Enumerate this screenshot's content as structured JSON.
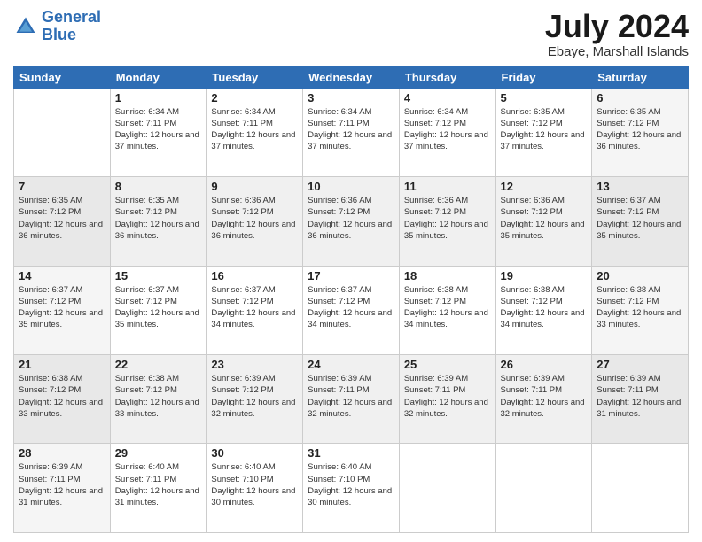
{
  "header": {
    "logo_line1": "General",
    "logo_line2": "Blue",
    "month_year": "July 2024",
    "location": "Ebaye, Marshall Islands"
  },
  "weekdays": [
    "Sunday",
    "Monday",
    "Tuesday",
    "Wednesday",
    "Thursday",
    "Friday",
    "Saturday"
  ],
  "weeks": [
    [
      {
        "day": "",
        "sunrise": "",
        "sunset": "",
        "daylight": ""
      },
      {
        "day": "1",
        "sunrise": "6:34 AM",
        "sunset": "7:11 PM",
        "daylight": "12 hours and 37 minutes."
      },
      {
        "day": "2",
        "sunrise": "6:34 AM",
        "sunset": "7:11 PM",
        "daylight": "12 hours and 37 minutes."
      },
      {
        "day": "3",
        "sunrise": "6:34 AM",
        "sunset": "7:11 PM",
        "daylight": "12 hours and 37 minutes."
      },
      {
        "day": "4",
        "sunrise": "6:34 AM",
        "sunset": "7:12 PM",
        "daylight": "12 hours and 37 minutes."
      },
      {
        "day": "5",
        "sunrise": "6:35 AM",
        "sunset": "7:12 PM",
        "daylight": "12 hours and 37 minutes."
      },
      {
        "day": "6",
        "sunrise": "6:35 AM",
        "sunset": "7:12 PM",
        "daylight": "12 hours and 36 minutes."
      }
    ],
    [
      {
        "day": "7",
        "sunrise": "6:35 AM",
        "sunset": "7:12 PM",
        "daylight": "12 hours and 36 minutes."
      },
      {
        "day": "8",
        "sunrise": "6:35 AM",
        "sunset": "7:12 PM",
        "daylight": "12 hours and 36 minutes."
      },
      {
        "day": "9",
        "sunrise": "6:36 AM",
        "sunset": "7:12 PM",
        "daylight": "12 hours and 36 minutes."
      },
      {
        "day": "10",
        "sunrise": "6:36 AM",
        "sunset": "7:12 PM",
        "daylight": "12 hours and 36 minutes."
      },
      {
        "day": "11",
        "sunrise": "6:36 AM",
        "sunset": "7:12 PM",
        "daylight": "12 hours and 35 minutes."
      },
      {
        "day": "12",
        "sunrise": "6:36 AM",
        "sunset": "7:12 PM",
        "daylight": "12 hours and 35 minutes."
      },
      {
        "day": "13",
        "sunrise": "6:37 AM",
        "sunset": "7:12 PM",
        "daylight": "12 hours and 35 minutes."
      }
    ],
    [
      {
        "day": "14",
        "sunrise": "6:37 AM",
        "sunset": "7:12 PM",
        "daylight": "12 hours and 35 minutes."
      },
      {
        "day": "15",
        "sunrise": "6:37 AM",
        "sunset": "7:12 PM",
        "daylight": "12 hours and 35 minutes."
      },
      {
        "day": "16",
        "sunrise": "6:37 AM",
        "sunset": "7:12 PM",
        "daylight": "12 hours and 34 minutes."
      },
      {
        "day": "17",
        "sunrise": "6:37 AM",
        "sunset": "7:12 PM",
        "daylight": "12 hours and 34 minutes."
      },
      {
        "day": "18",
        "sunrise": "6:38 AM",
        "sunset": "7:12 PM",
        "daylight": "12 hours and 34 minutes."
      },
      {
        "day": "19",
        "sunrise": "6:38 AM",
        "sunset": "7:12 PM",
        "daylight": "12 hours and 34 minutes."
      },
      {
        "day": "20",
        "sunrise": "6:38 AM",
        "sunset": "7:12 PM",
        "daylight": "12 hours and 33 minutes."
      }
    ],
    [
      {
        "day": "21",
        "sunrise": "6:38 AM",
        "sunset": "7:12 PM",
        "daylight": "12 hours and 33 minutes."
      },
      {
        "day": "22",
        "sunrise": "6:38 AM",
        "sunset": "7:12 PM",
        "daylight": "12 hours and 33 minutes."
      },
      {
        "day": "23",
        "sunrise": "6:39 AM",
        "sunset": "7:12 PM",
        "daylight": "12 hours and 32 minutes."
      },
      {
        "day": "24",
        "sunrise": "6:39 AM",
        "sunset": "7:11 PM",
        "daylight": "12 hours and 32 minutes."
      },
      {
        "day": "25",
        "sunrise": "6:39 AM",
        "sunset": "7:11 PM",
        "daylight": "12 hours and 32 minutes."
      },
      {
        "day": "26",
        "sunrise": "6:39 AM",
        "sunset": "7:11 PM",
        "daylight": "12 hours and 32 minutes."
      },
      {
        "day": "27",
        "sunrise": "6:39 AM",
        "sunset": "7:11 PM",
        "daylight": "12 hours and 31 minutes."
      }
    ],
    [
      {
        "day": "28",
        "sunrise": "6:39 AM",
        "sunset": "7:11 PM",
        "daylight": "12 hours and 31 minutes."
      },
      {
        "day": "29",
        "sunrise": "6:40 AM",
        "sunset": "7:11 PM",
        "daylight": "12 hours and 31 minutes."
      },
      {
        "day": "30",
        "sunrise": "6:40 AM",
        "sunset": "7:10 PM",
        "daylight": "12 hours and 30 minutes."
      },
      {
        "day": "31",
        "sunrise": "6:40 AM",
        "sunset": "7:10 PM",
        "daylight": "12 hours and 30 minutes."
      },
      {
        "day": "",
        "sunrise": "",
        "sunset": "",
        "daylight": ""
      },
      {
        "day": "",
        "sunrise": "",
        "sunset": "",
        "daylight": ""
      },
      {
        "day": "",
        "sunrise": "",
        "sunset": "",
        "daylight": ""
      }
    ]
  ]
}
